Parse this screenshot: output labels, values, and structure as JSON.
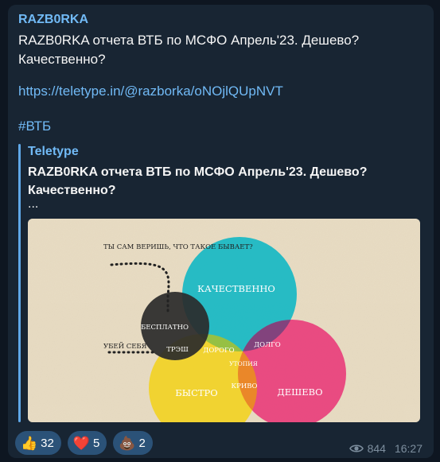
{
  "message": {
    "channel": "RAZB0RKA",
    "text_lines": [
      "RAZB0RKA отчета ВТБ по МСФО Апрель'23. Дешево?",
      "Качественно?"
    ],
    "link": "https://teletype.in/@razborka/oNOjlQUpNVT",
    "hashtag": "#ВТБ"
  },
  "preview": {
    "site": "Teletype",
    "title": "RAZB0RKA отчета ВТБ по МСФО Апрель'23. Дешево? Качественно?",
    "description": "...",
    "image": {
      "caption_top": "ТЫ САМ ВЕРИШЬ, ЧТО ТАКОЕ БЫВАЕТ?",
      "caption_left": "УБЕЙ СЕБЯ",
      "circles": {
        "quality": "КАЧЕСТВЕННО",
        "cheap": "ДЕШЕВО",
        "fast": "БЫСТРО",
        "free": "БЕСПЛАТНО"
      },
      "overlaps": {
        "trash": "ТРЭШ",
        "expensive": "ДОРОГО",
        "long": "ДОЛГО",
        "utopia": "УТОПИЯ",
        "crooked": "КРИВО"
      },
      "colors": {
        "quality": "#18b8c4",
        "cheap": "#e8407c",
        "fast": "#f2d21c",
        "free": "#2a2a2a",
        "paper": "#e8dcc3"
      }
    }
  },
  "reactions": [
    {
      "emoji": "👍",
      "icon": "thumbs-up-icon",
      "count": "32"
    },
    {
      "emoji": "❤️",
      "icon": "heart-icon",
      "count": "5"
    },
    {
      "emoji": "💩",
      "icon": "poop-icon",
      "count": "2"
    }
  ],
  "meta": {
    "views": "844",
    "time": "16:27"
  }
}
